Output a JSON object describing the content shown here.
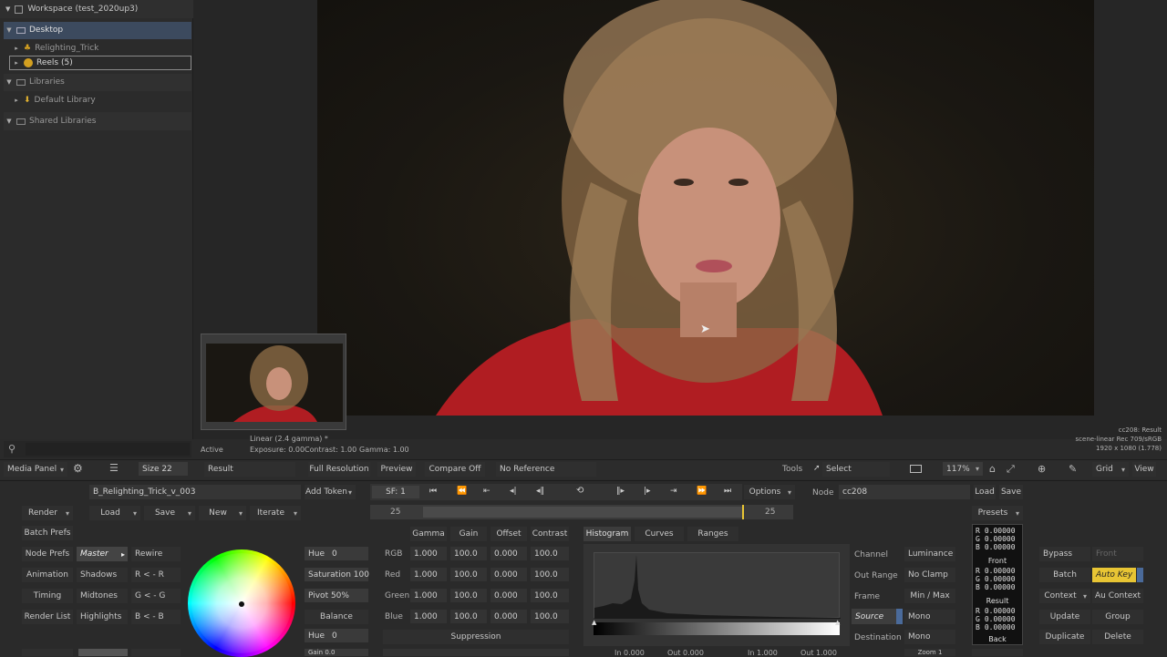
{
  "workspace": {
    "title": "Workspace (test_2020up3)"
  },
  "tree": [
    {
      "label": "Desktop",
      "caret": "▼",
      "icon": "desktop-icon"
    },
    {
      "label": "Relighting_Trick",
      "caret": "▸",
      "icon": "batch-icon"
    },
    {
      "label": "Reels (5)",
      "caret": "▸",
      "icon": "reels-icon"
    },
    {
      "label": "Libraries",
      "caret": "▼",
      "icon": "folder-icon"
    },
    {
      "label": "Default Library",
      "caret": "▸",
      "icon": "library-icon"
    },
    {
      "label": "Shared Libraries",
      "caret": "▼",
      "icon": "folder-icon"
    }
  ],
  "viewer": {
    "status": "Active",
    "colorspace": "Linear (2.4 gamma) *",
    "exposure": "Exposure: 0.00",
    "contrast": "Contrast: 1.00",
    "gamma": "Gamma: 1.00",
    "info_node": "cc208: Result",
    "info_space": "scene-linear Rec 709/sRGB",
    "info_res": "1920 x 1080 (1.778)"
  },
  "toolbar": {
    "media_panel": "Media Panel",
    "size": "Size 22",
    "result": "Result",
    "full_res": "Full Resolution",
    "preview": "Preview",
    "compare": "Compare Off",
    "reference": "No Reference",
    "tools": "Tools",
    "select": "Select",
    "zoom": "117%",
    "grid": "Grid",
    "view": "View"
  },
  "batch": {
    "render": "Render",
    "load": "Load",
    "save": "Save",
    "new": "New",
    "iterate": "Iterate",
    "batch_prefs": "Batch Prefs",
    "node_prefs": "Node Prefs",
    "animation": "Animation",
    "timing": "Timing",
    "render_list": "Render List",
    "name": "B_Relighting_Trick_v_003",
    "add_token": "Add Token"
  },
  "ranges": {
    "master": "Master",
    "shadows": "Shadows",
    "midtones": "Midtones",
    "highlights": "Highlights",
    "rewire": "Rewire",
    "r": "R < - R",
    "g": "G < - G",
    "b": "B < - B"
  },
  "color": {
    "hue": "Hue",
    "hue_val": "0",
    "saturation": "Saturation 100",
    "pivot": "Pivot 50%",
    "balance": "Balance",
    "hue2": "Hue",
    "hue2_val": "0",
    "gain2": "Gain 0.0"
  },
  "transport": {
    "sf": "SF: 1",
    "frame_left": "25",
    "frame_right": "25",
    "options": "Options"
  },
  "grade": {
    "headers": [
      "Gamma",
      "Gain",
      "Offset",
      "Contrast"
    ],
    "rows": [
      {
        "label": "RGB",
        "values": [
          "1.000",
          "100.0",
          "0.000",
          "100.0"
        ]
      },
      {
        "label": "Red",
        "values": [
          "1.000",
          "100.0",
          "0.000",
          "100.0"
        ]
      },
      {
        "label": "Green",
        "values": [
          "1.000",
          "100.0",
          "0.000",
          "100.0"
        ]
      },
      {
        "label": "Blue",
        "values": [
          "1.000",
          "100.0",
          "0.000",
          "100.0"
        ]
      }
    ],
    "suppression": "Suppression"
  },
  "hist": {
    "tabs": [
      "Histogram",
      "Curves",
      "Ranges"
    ],
    "in_label": "In 0.000",
    "out_label": "Out 0.000",
    "in2_label": "In 1.000",
    "out2_label": "Out 1.000"
  },
  "node": {
    "label": "Node",
    "name": "cc208",
    "load": "Load",
    "save": "Save",
    "presets": "Presets"
  },
  "channel": {
    "channel": "Channel",
    "channel_val": "Luminance",
    "out_range": "Out Range",
    "out_range_val": "No Clamp",
    "frame": "Frame",
    "frame_val": "Min / Max",
    "source": "Source",
    "source_val": "Mono",
    "destination": "Destination",
    "destination_val": "Mono",
    "zoom_val": "Zoom 1"
  },
  "readout": {
    "top": {
      "r": "0.00000",
      "g": "0.00000",
      "b": "0.00000"
    },
    "front_label": "Front",
    "front": {
      "r": "0.00000",
      "g": "0.00000",
      "b": "0.00000"
    },
    "result_label": "Result",
    "result": {
      "r": "0.00000",
      "g": "0.00000",
      "b": "0.00000"
    },
    "back_label": "Back",
    "r": "R",
    "g": "G",
    "b": "B"
  },
  "right": {
    "bypass": "Bypass",
    "front": "Front",
    "batch": "Batch",
    "auto_key": "Auto Key",
    "context": "Context",
    "au_context": "Au Context",
    "update": "Update",
    "group": "Group",
    "duplicate": "Duplicate",
    "delete": "Delete"
  },
  "colors": {
    "accent_yellow": "#e8c534",
    "selection_blue": "#3c4a5e",
    "viewer_bg": "#1a1712"
  }
}
